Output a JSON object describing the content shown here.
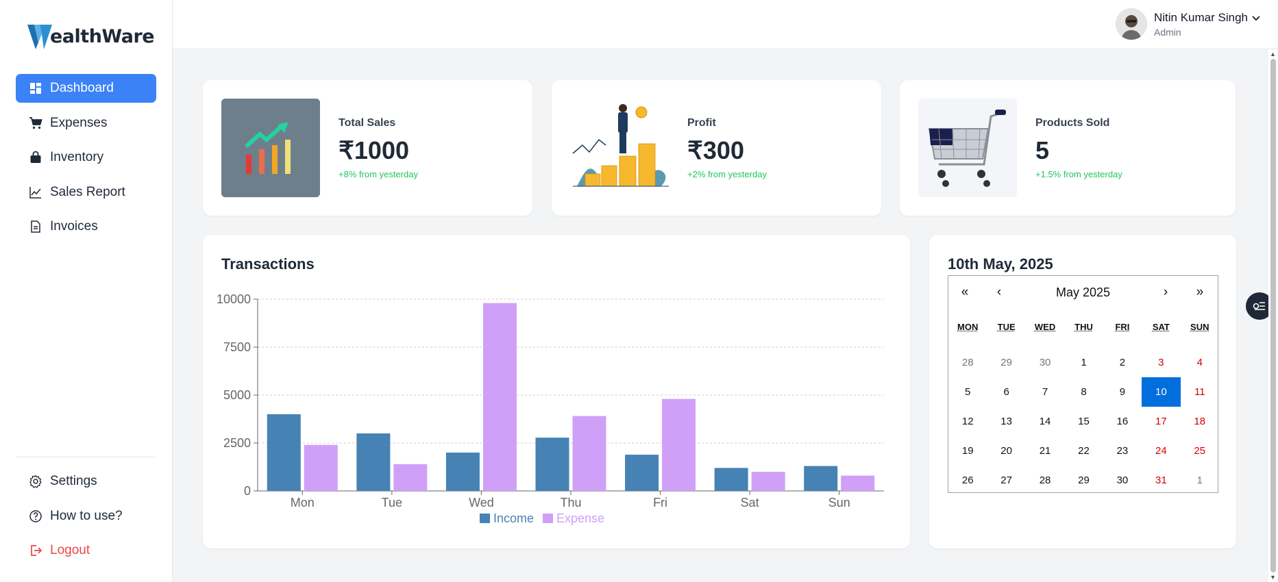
{
  "app": {
    "logo_text": "ealthWare"
  },
  "sidebar": {
    "items": [
      {
        "label": "Dashboard",
        "icon": "dashboard-icon"
      },
      {
        "label": "Expenses",
        "icon": "cart-icon"
      },
      {
        "label": "Inventory",
        "icon": "bag-icon"
      },
      {
        "label": "Sales Report",
        "icon": "line-chart-icon"
      },
      {
        "label": "Invoices",
        "icon": "document-icon"
      }
    ],
    "bottom": [
      {
        "label": "Settings",
        "icon": "gear-icon"
      },
      {
        "label": "How to use?",
        "icon": "help-icon"
      },
      {
        "label": "Logout",
        "icon": "logout-icon"
      }
    ]
  },
  "header": {
    "user_name": "Nitin Kumar Singh",
    "user_role": "Admin"
  },
  "stats": [
    {
      "label": "Total Sales",
      "value": "₹1000",
      "change": "+8% from yesterday"
    },
    {
      "label": "Profit",
      "value": "₹300",
      "change": "+2% from yesterday"
    },
    {
      "label": "Products Sold",
      "value": "5",
      "change": "+1.5% from yesterday"
    }
  ],
  "transactions": {
    "title": "Transactions"
  },
  "chart_data": {
    "type": "bar",
    "title": "Transactions",
    "categories": [
      "Mon",
      "Tue",
      "Wed",
      "Thu",
      "Fri",
      "Sat",
      "Sun"
    ],
    "series": [
      {
        "name": "Income",
        "color": "#4682b4",
        "values": [
          4000,
          3000,
          2000,
          2780,
          1890,
          1200,
          1300
        ]
      },
      {
        "name": "Expense",
        "color": "#d0a0f8",
        "values": [
          2400,
          1398,
          9800,
          3908,
          4800,
          1000,
          800
        ]
      }
    ],
    "yticks": [
      "0",
      "2500",
      "5000",
      "7500",
      "10000"
    ],
    "ylim": [
      0,
      10000
    ],
    "grid": true,
    "legend": "bottom"
  },
  "calendar": {
    "selected_date_label": "10th May, 2025",
    "month_label": "May 2025",
    "nav": {
      "prev_year": "«",
      "prev_month": "‹",
      "next_month": "›",
      "next_year": "»"
    },
    "weekdays": [
      "MON",
      "TUE",
      "WED",
      "THU",
      "FRI",
      "SAT",
      "SUN"
    ],
    "days": [
      "28",
      "29",
      "30",
      "1",
      "2",
      "3",
      "4",
      "5",
      "6",
      "7",
      "8",
      "9",
      "10",
      "11",
      "12",
      "13",
      "14",
      "15",
      "16",
      "17",
      "18",
      "19",
      "20",
      "21",
      "22",
      "23",
      "24",
      "25",
      "26",
      "27",
      "28",
      "29",
      "30",
      "31",
      "1"
    ],
    "selected_day": "10"
  }
}
